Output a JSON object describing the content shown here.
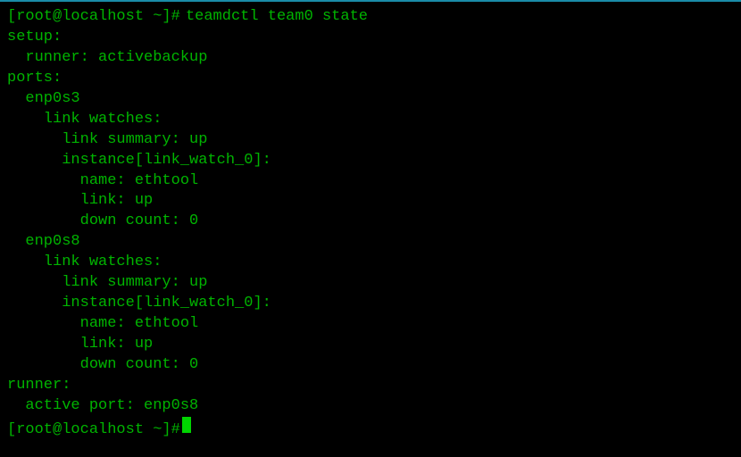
{
  "prompt1": {
    "user_host": "[root@localhost ~]#",
    "command": "teamdctl team0 state"
  },
  "output": {
    "l1": "setup:",
    "l2": "  runner: activebackup",
    "l3": "ports:",
    "l4": "  enp0s3",
    "l5": "    link watches:",
    "l6": "      link summary: up",
    "l7": "      instance[link_watch_0]:",
    "l8": "        name: ethtool",
    "l9": "        link: up",
    "l10": "        down count: 0",
    "l11": "  enp0s8",
    "l12": "    link watches:",
    "l13": "      link summary: up",
    "l14": "      instance[link_watch_0]:",
    "l15": "        name: ethtool",
    "l16": "        link: up",
    "l17": "        down count: 0",
    "l18": "runner:",
    "l19": "  active port: enp0s8"
  },
  "prompt2": {
    "user_host": "[root@localhost ~]#"
  }
}
